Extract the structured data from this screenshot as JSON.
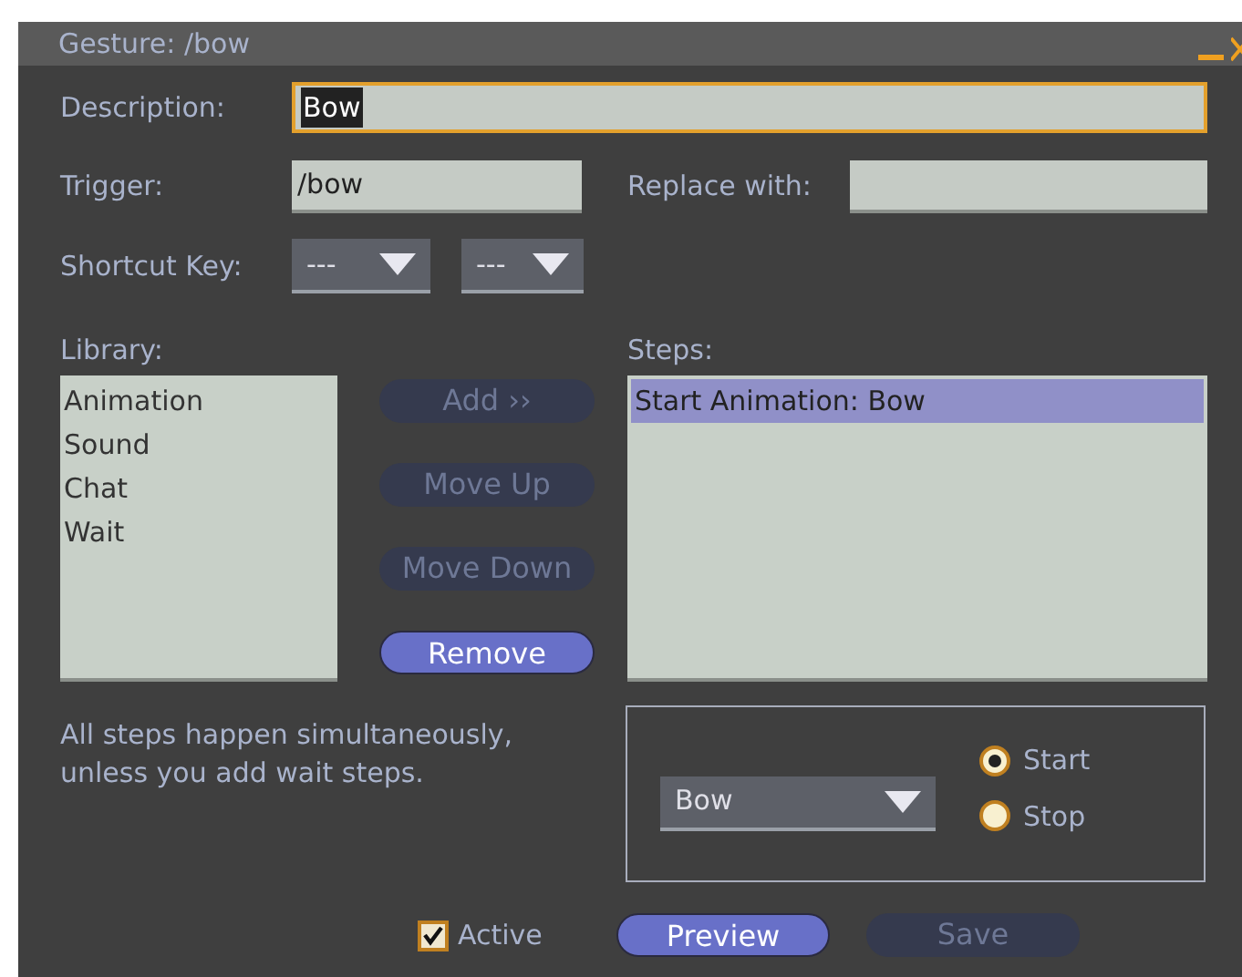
{
  "window": {
    "title": "Gesture: /bow"
  },
  "description": {
    "label": "Description:",
    "value": "Bow",
    "focused": true
  },
  "trigger": {
    "label": "Trigger:",
    "value": "/bow"
  },
  "replace_with": {
    "label": "Replace with:"
  },
  "shortcut_key": {
    "label": "Shortcut Key:",
    "modifier": "---",
    "key": "---"
  },
  "library": {
    "label": "Library:",
    "items": [
      {
        "label": "Animation",
        "selected": false
      },
      {
        "label": "Sound",
        "selected": false
      },
      {
        "label": "Chat",
        "selected": false
      },
      {
        "label": "Wait",
        "selected": false
      }
    ]
  },
  "step_buttons": [
    {
      "label": "Add ››",
      "disabled": true
    },
    {
      "label": "Move Up",
      "disabled": true
    },
    {
      "label": "Move Down",
      "disabled": true
    },
    {
      "label": "Remove",
      "disabled": false
    }
  ],
  "steps": {
    "label": "Steps:",
    "items": [
      {
        "label": "Start Animation: Bow",
        "selected": true
      }
    ]
  },
  "note": "All steps happen simultaneously, unless you add wait steps.",
  "step_options": {
    "animation": "Bow",
    "radios": [
      {
        "label": "Start",
        "selected": true
      },
      {
        "label": "Stop",
        "selected": false
      }
    ]
  },
  "active": {
    "label": "Active",
    "checked": true
  },
  "bottom_buttons": [
    {
      "label": "Preview",
      "disabled": false
    },
    {
      "label": "Save",
      "disabled": true
    }
  ]
}
